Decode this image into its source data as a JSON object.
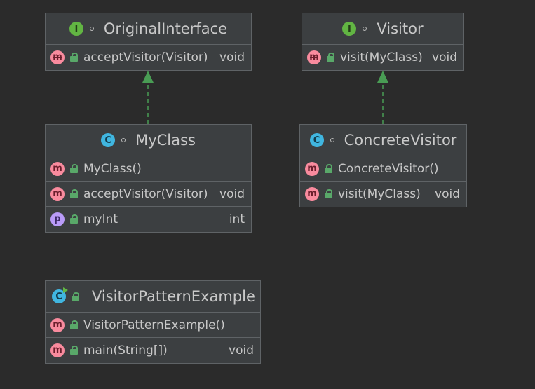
{
  "nodes": {
    "original_interface": {
      "title": "OriginalInterface",
      "kind": "interface",
      "badge_letter": "I",
      "members": [
        {
          "name": "acceptVisitor(Visitor)",
          "type": "void",
          "kind": "abstract-method",
          "badge_letter": "m"
        }
      ]
    },
    "visitor": {
      "title": "Visitor",
      "kind": "interface",
      "badge_letter": "I",
      "members": [
        {
          "name": "visit(MyClass)",
          "type": "void",
          "kind": "abstract-method",
          "badge_letter": "m"
        }
      ]
    },
    "my_class": {
      "title": "MyClass",
      "kind": "class",
      "badge_letter": "C",
      "members": [
        {
          "name": "MyClass()",
          "type": "",
          "kind": "method",
          "badge_letter": "m"
        },
        {
          "name": "acceptVisitor(Visitor)",
          "type": "void",
          "kind": "method",
          "badge_letter": "m"
        },
        {
          "name": "myInt",
          "type": "int",
          "kind": "property",
          "badge_letter": "p"
        }
      ]
    },
    "concrete_visitor": {
      "title": "ConcreteVisitor",
      "kind": "class",
      "badge_letter": "C",
      "members": [
        {
          "name": "ConcreteVisitor()",
          "type": "",
          "kind": "method",
          "badge_letter": "m"
        },
        {
          "name": "visit(MyClass)",
          "type": "void",
          "kind": "method",
          "badge_letter": "m"
        }
      ]
    },
    "visitor_pattern_example": {
      "title": "VisitorPatternExample",
      "kind": "class",
      "badge_letter": "C",
      "members": [
        {
          "name": "VisitorPatternExample()",
          "type": "",
          "kind": "method",
          "badge_letter": "m"
        },
        {
          "name": "main(String[])",
          "type": "void",
          "kind": "method",
          "badge_letter": "m"
        }
      ]
    }
  },
  "edges": [
    {
      "from": "MyClass",
      "to": "OriginalInterface",
      "relation": "implements"
    },
    {
      "from": "ConcreteVisitor",
      "to": "Visitor",
      "relation": "implements"
    }
  ],
  "colors": {
    "background": "#2b2b2b",
    "node_fill": "#3c3f41",
    "node_border": "#5f6366",
    "edge": "#499c54",
    "interface_badge": "#62b543",
    "class_badge": "#40b6e0",
    "method_badge": "#f98b9e",
    "property_badge": "#b99bf8"
  }
}
